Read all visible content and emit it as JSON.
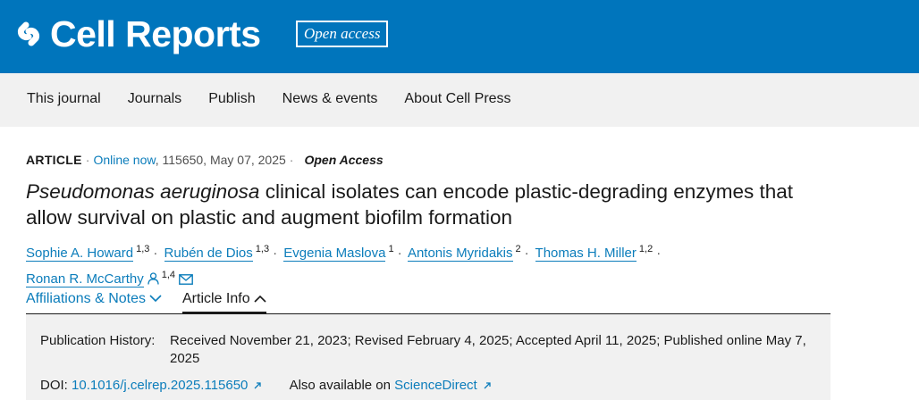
{
  "header": {
    "logo_text": "Cell Reports",
    "badge": "Open access",
    "brand_color": "#0075bc"
  },
  "nav": {
    "items": [
      "This journal",
      "Journals",
      "Publish",
      "News & events",
      "About Cell Press"
    ]
  },
  "article": {
    "type": "ARTICLE",
    "status": "Online now",
    "citation": "115650, May 07, 2025",
    "access": "Open Access",
    "title_italic": "Pseudomonas aeruginosa",
    "title_rest": " clinical isolates can encode plastic-degrading enzymes that allow survival on plastic and augment biofilm formation",
    "authors": [
      {
        "name": "Sophie A. Howard",
        "sup": "1,3"
      },
      {
        "name": "Rubén de Dios",
        "sup": "1,3"
      },
      {
        "name": "Evgenia Maslova",
        "sup": "1"
      },
      {
        "name": "Antonis Myridakis",
        "sup": "2"
      },
      {
        "name": "Thomas H. Miller",
        "sup": "1,2"
      },
      {
        "name": "Ronan R. McCarthy",
        "sup": "1,4"
      }
    ],
    "author_icons": [
      "person-icon",
      "envelope-icon"
    ]
  },
  "tabs": {
    "affiliations": "Affiliations & Notes",
    "article_info": "Article Info"
  },
  "info": {
    "history_label": "Publication History:",
    "history_value": "Received November 21, 2023; Revised February 4, 2025; Accepted April 11, 2025; Published online May 7, 2025",
    "doi_label": "DOI:",
    "doi_value": "10.1016/j.celrep.2025.115650",
    "also_label": "Also available on",
    "also_link": "ScienceDirect"
  },
  "colors": {
    "link": "#0c7dbb",
    "nav_bg": "#f1f1f1",
    "info_bg": "#f1f1f1"
  }
}
